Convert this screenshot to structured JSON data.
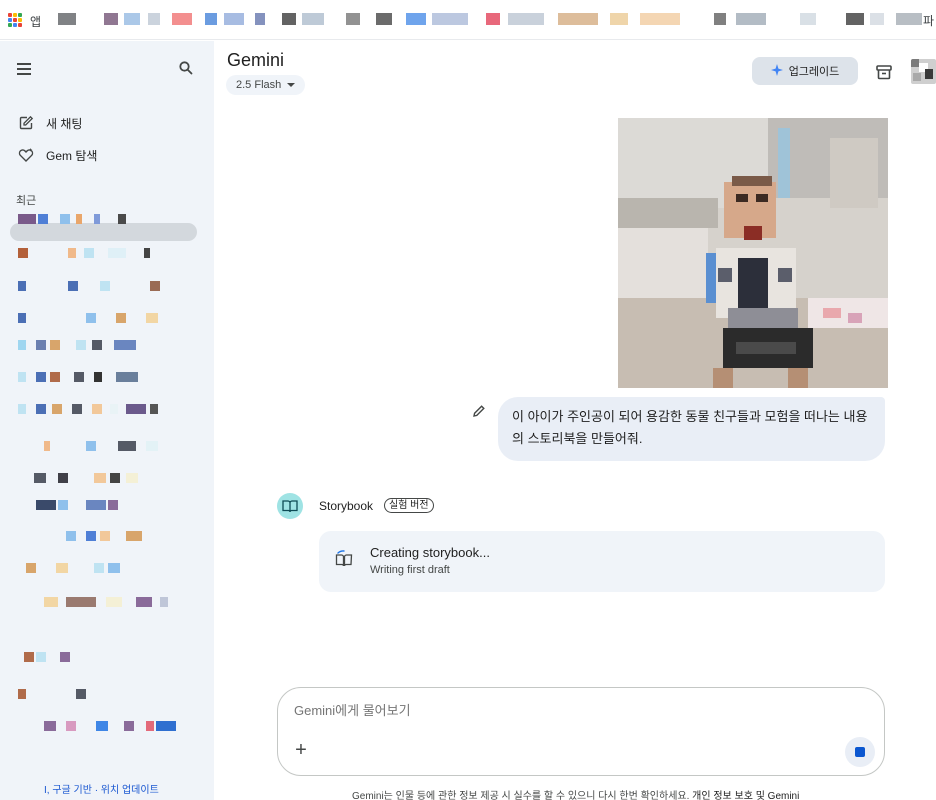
{
  "bookmarks": {
    "apps_label": "앱",
    "end_label": "파"
  },
  "sidebar": {
    "menu_icon": "menu-icon",
    "search_icon": "search-icon",
    "new_chat": "새 채팅",
    "explore_gems": "Gem 탐색",
    "recent_label": "최근",
    "footer": "I, 구글 기반 · 위치 업데이트"
  },
  "header": {
    "title": "Gemini",
    "model": "2.5 Flash",
    "upgrade": "업그레이드"
  },
  "chat": {
    "user_message": "이 아이가 주인공이 되어 용감한 동물 친구들과 모험을 떠나는 내용의 스토리북을 만들어줘.",
    "gem_name": "Storybook",
    "gem_badge": "실험 버전",
    "card_title": "Creating storybook...",
    "card_subtitle": "Writing first draft"
  },
  "input": {
    "placeholder": "Gemini에게 물어보기"
  },
  "footer": {
    "disclaimer": "Gemini는 인물 등에 관한 정보 제공 시 실수를 할 수 있으니 다시 한번 확인하세요.",
    "privacy_link": "개인 정보 보호 및 Gemini"
  },
  "colors": {
    "sidebar_bg": "#f0f4f9",
    "bubble_bg": "#e9eef6",
    "accent": "#0b57d0",
    "gem_icon_bg": "#9fe3e4"
  }
}
